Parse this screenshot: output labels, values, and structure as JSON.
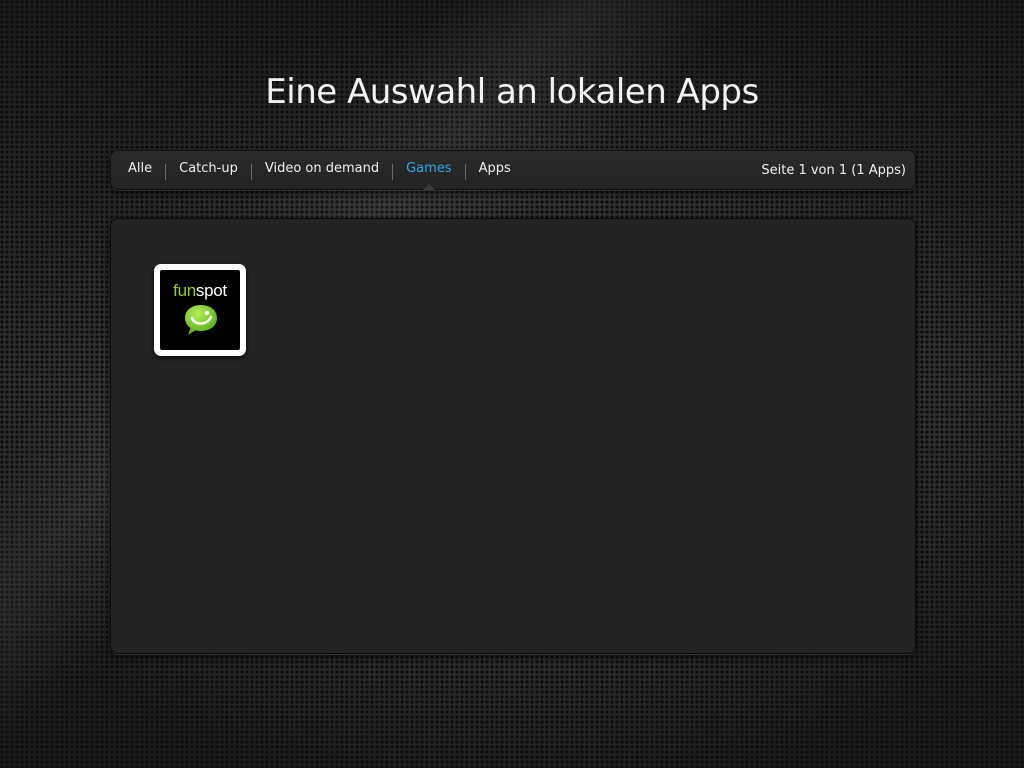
{
  "header": {
    "title": "Eine Auswahl an lokalen Apps"
  },
  "nav": {
    "tabs": [
      {
        "label": "Alle",
        "active": false
      },
      {
        "label": "Catch-up",
        "active": false
      },
      {
        "label": "Video on demand",
        "active": false
      },
      {
        "label": "Games",
        "active": true
      },
      {
        "label": "Apps",
        "active": false
      }
    ],
    "page_status": "Seite 1 von 1 (1 Apps)"
  },
  "apps": [
    {
      "logo_text_part1": "fun",
      "logo_text_part2": "spot",
      "icon": "chat-bubble-smiley-icon"
    }
  ],
  "colors": {
    "active_tab": "#2fa8ea",
    "logo_green": "#8fd12b",
    "panel": "#232323"
  }
}
